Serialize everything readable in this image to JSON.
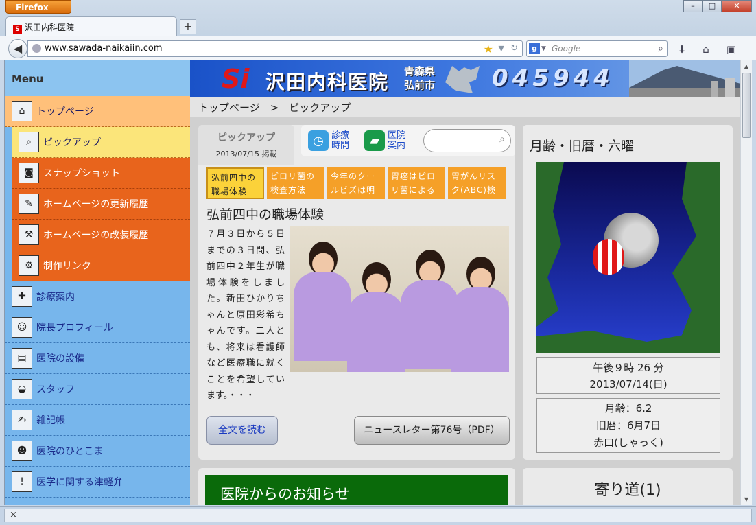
{
  "browser": {
    "app_button": "Firefox",
    "tab_title": "沢田内科医院",
    "new_tab": "+",
    "url": "www.sawada-naikaiin.com",
    "search_placeholder": "Google",
    "status_close": "×"
  },
  "sidebar": {
    "heading": "Menu",
    "items": [
      {
        "label": "トップページ"
      },
      {
        "label": "ピックアップ"
      },
      {
        "label": "スナップショット"
      },
      {
        "label": "ホームページの更新履歴"
      },
      {
        "label": "ホームページの改装履歴"
      },
      {
        "label": "制作リンク"
      },
      {
        "label": "診療案内"
      },
      {
        "label": "院長プロフィール"
      },
      {
        "label": "医院の設備"
      },
      {
        "label": "スタッフ"
      },
      {
        "label": "雑記帳"
      },
      {
        "label": "医院のひとこま"
      },
      {
        "label": "医学に関する津軽弁"
      }
    ]
  },
  "banner": {
    "logo": "Si",
    "name": "沢田内科医院",
    "pref1": "青森県",
    "pref2": "弘前市",
    "phone": "045944"
  },
  "breadcrumb": "トップページ　>　ピックアップ",
  "pickup": {
    "badge_title": "ピックアップ",
    "badge_date": "2013/07/15 掲載",
    "quick1": {
      "line1": "診療",
      "line2": "時間"
    },
    "quick2": {
      "line1": "医院",
      "line2": "案内"
    },
    "tabs": [
      {
        "label": "弘前四中の職場体験"
      },
      {
        "label": "ピロリ菌の検査方法"
      },
      {
        "label": "今年のクールビズは明"
      },
      {
        "label": "胃癌はピロリ菌による"
      },
      {
        "label": "胃がんリスク(ABC)検診"
      }
    ],
    "article_title": "弘前四中の職場体験",
    "article_text": "７月３日から５日までの３日間、弘前四中２年生が職場体験をしました。新田ひかりちゃんと原田彩希ちゃんです。二人とも、将来は看護師など医療職に就くことを希望しています。・・・",
    "read_more": "全文を読む",
    "newsletter": "ニュースレター第76号（PDF）"
  },
  "moon": {
    "heading": "月齢・旧暦・六曜",
    "time": "午後９時 26 分",
    "date": "2013/07/14(日)",
    "age": "月齢：6.2",
    "lunar": "旧暦：6月7日",
    "rokuyo": "赤口(しゃっく)"
  },
  "notice": {
    "title": "医院からのお知らせ"
  },
  "yorimichi": {
    "title": "寄り道(1)"
  },
  "colors": {
    "orange": "#e8641c",
    "blue": "#77b6ec",
    "green": "#0a6a0a"
  }
}
